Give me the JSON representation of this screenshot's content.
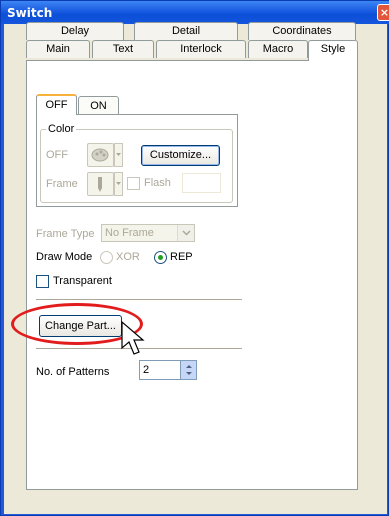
{
  "window": {
    "title": "Switch",
    "close_glyph": "×"
  },
  "tabs": {
    "row_back": [
      "Delay",
      "Detail",
      "Coordinates"
    ],
    "row_front": [
      "Main",
      "Text",
      "Interlock",
      "Macro",
      "Style"
    ],
    "active": "Style"
  },
  "subtabs": {
    "items": [
      "OFF",
      "ON"
    ],
    "active": "OFF"
  },
  "color_group": {
    "title": "Color",
    "off_label": "OFF",
    "frame_label": "Frame",
    "customize_button": "Customize...",
    "flash_label": "Flash",
    "flash_checked": false
  },
  "frame_type": {
    "label": "Frame Type",
    "value": "No Frame"
  },
  "draw_mode": {
    "label": "Draw Mode",
    "options": [
      "XOR",
      "REP"
    ],
    "selected": "REP"
  },
  "transparent": {
    "label": "Transparent",
    "checked": false
  },
  "change_part_button": "Change Part...",
  "patterns": {
    "label": "No. of Patterns",
    "value": "2"
  },
  "icons": {
    "palette": "palette-icon",
    "pen": "pen-icon",
    "cursor": "mouse-pointer-icon"
  },
  "colors": {
    "title_bar": "#0b4fd8",
    "dialog_bg": "#ece9d8",
    "highlight": "#e21c1c",
    "active_subtab_accent": "#f6b23a",
    "radio_selected": "#21a121"
  }
}
